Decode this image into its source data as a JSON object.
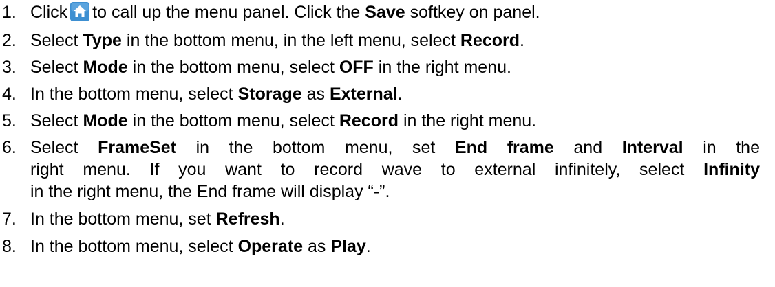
{
  "steps": [
    {
      "num": "1.",
      "parts": [
        "Click",
        "to call up the menu panel. Click the",
        "Save",
        "softkey on panel."
      ],
      "icon": "home-icon",
      "icon_color": "#3d8fd1"
    },
    {
      "num": "2.",
      "parts": [
        "Select",
        "Type",
        "in the bottom menu, in the left menu, select",
        "Record",
        "."
      ]
    },
    {
      "num": "3.",
      "parts": [
        "Select",
        "Mode",
        "in the bottom menu, select",
        "OFF",
        "in the right menu."
      ]
    },
    {
      "num": "4.",
      "parts": [
        "In the bottom menu, select",
        "Storage",
        "as",
        "External",
        "."
      ]
    },
    {
      "num": "5.",
      "parts": [
        "Select",
        "Mode",
        "in the bottom menu, select",
        "Record",
        "in the right menu."
      ]
    },
    {
      "num": "6.",
      "parts": [
        "Select",
        "FrameSet",
        "in the bottom menu, set",
        "End frame",
        "and",
        "Interval",
        "in the",
        "right menu. If you want to record wave to external infinitely, select",
        "Infinity",
        "in the right menu, the End frame will display “-”."
      ]
    },
    {
      "num": "7.",
      "parts": [
        "In the bottom menu, set",
        "Refresh",
        "."
      ]
    },
    {
      "num": "8.",
      "parts": [
        "In the bottom menu, select",
        "Operate",
        "as",
        "Play",
        "."
      ]
    }
  ]
}
